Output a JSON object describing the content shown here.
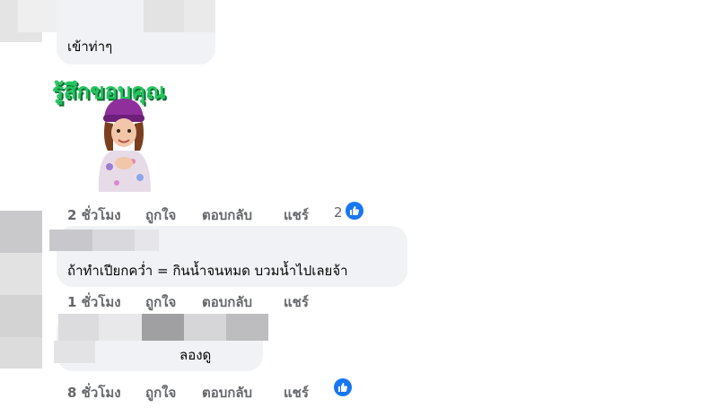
{
  "comments": [
    {
      "text": "เข้าท่าๆ",
      "sticker_text": "รู้สึกขอบคุณ",
      "time": "2 ชั่วโมง",
      "like": "ถูกใจ",
      "reply": "ตอบกลับ",
      "share": "แชร์",
      "reaction_count": "2"
    },
    {
      "text": "ถ้าทำเปียกคว่ำ = กินน้ำจนหมด บวมน้ำไปเลยจ้า",
      "time": "1 ชั่วโมง",
      "like": "ถูกใจ",
      "reply": "ตอบกลับ",
      "share": "แชร์"
    },
    {
      "text": "ลองดู",
      "time": "8 ชั่วโมง",
      "like": "ถูกใจ",
      "reply": "ตอบกลับ",
      "share": "แชร์"
    }
  ],
  "colors": {
    "bubble": "#f0f2f5",
    "meta": "#65676b",
    "like_blue": "#1877f2",
    "sticker_green": "#22c55e"
  },
  "icons": [
    "like-thumb-icon",
    "avatar-character-sticker"
  ]
}
